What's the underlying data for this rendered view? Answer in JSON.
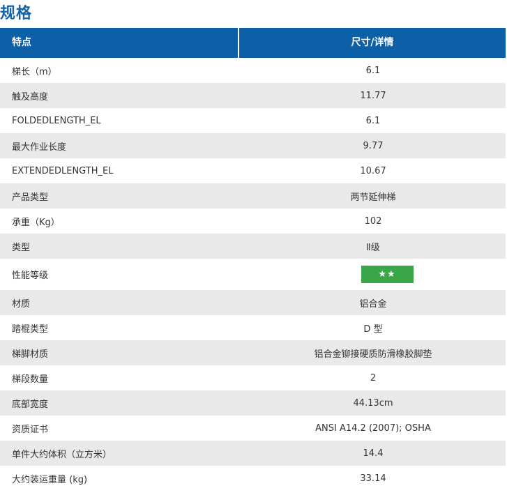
{
  "section": {
    "title": "规格"
  },
  "table": {
    "header": {
      "feature": "特点",
      "detail": "尺寸/详情"
    },
    "rows": [
      {
        "label": "梯长（m）",
        "value": "6.1"
      },
      {
        "label": "触及高度",
        "value": "11.77"
      },
      {
        "label": "FOLDEDLENGTH_EL",
        "value": "6.1"
      },
      {
        "label": "最大作业长度",
        "value": "9.77"
      },
      {
        "label": "EXTENDEDLENGTH_EL",
        "value": "10.67"
      },
      {
        "label": "产品类型",
        "value": "两节延伸梯"
      },
      {
        "label": "承重（Kg）",
        "value": "102"
      },
      {
        "label": "类型",
        "value": "Ⅱ级"
      },
      {
        "label": "性能等级",
        "value": "★★",
        "rating_stars": 2
      },
      {
        "label": "材质",
        "value": "铝合金"
      },
      {
        "label": "踏棍类型",
        "value": "D 型"
      },
      {
        "label": "梯脚材质",
        "value": "铝合金铆接硬质防滑橡胶脚垫"
      },
      {
        "label": "梯段数量",
        "value": "2"
      },
      {
        "label": "底部宽度",
        "value": "44.13cm"
      },
      {
        "label": "资质证书",
        "value": "ANSI A14.2 (2007); OSHA"
      },
      {
        "label": "单件大约体积（立方米）",
        "value": "14.4"
      },
      {
        "label": "大约装运重量 (kg)",
        "value": "33.14"
      }
    ]
  },
  "colors": {
    "header_bg": "#0d5fa8",
    "title_text": "#1565a8",
    "alt_row_bg": "#e9e9e9",
    "rating_badge": "#3aa64a"
  }
}
